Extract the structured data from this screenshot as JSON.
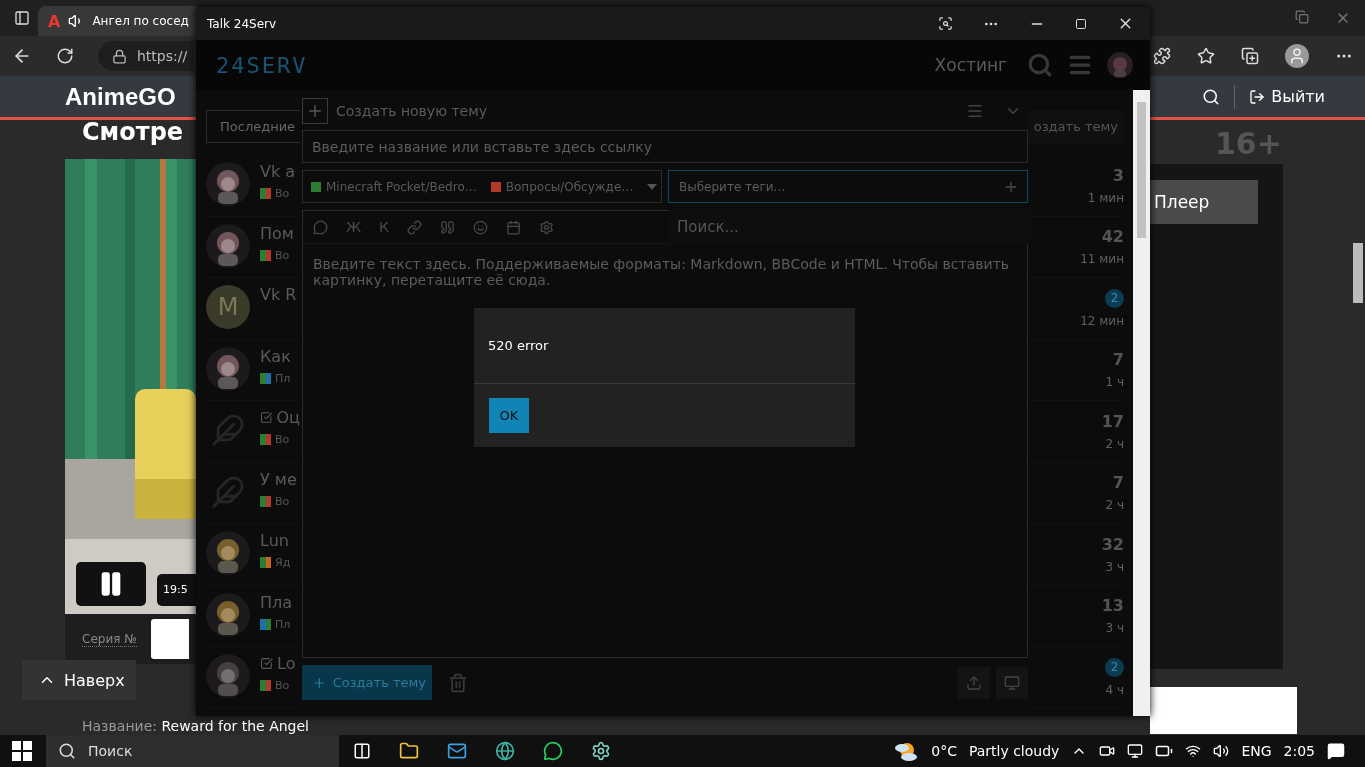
{
  "browser": {
    "tabs": [
      {
        "favicon": "A",
        "title": "Ангел по сосед",
        "selected": true
      }
    ],
    "address": "https://",
    "site": {
      "logo": "AnimeGO",
      "logout": "Выйти",
      "heading": "Смотре",
      "video_time": "19:5",
      "episode_label": "Серия №",
      "back_to_top": "Наверх",
      "title_label": "Название:",
      "title_value": "Reward for the Angel",
      "rating": "16+",
      "player_button": "Плеер"
    }
  },
  "app": {
    "title": "Talk 24Serv",
    "logo": "24SERV",
    "nav_link": "Хостинг",
    "filter": "Последние",
    "create_topic": "оздать тему",
    "topics": [
      {
        "title": "Vk a",
        "solved": false,
        "category": "Во",
        "tags": [
          {
            "color": "#2e7d32"
          },
          {
            "color": "#b23a2a"
          }
        ],
        "count": "3",
        "badge": false,
        "time": "1 мин"
      },
      {
        "title": "Пом",
        "solved": false,
        "category": "Во",
        "tags": [
          {
            "color": "#2e7d32"
          },
          {
            "color": "#b23a2a"
          }
        ],
        "count": "42",
        "badge": false,
        "time": "11 мин"
      },
      {
        "title": "Vk R",
        "solved": false,
        "avatar": {
          "kind": "letter",
          "letter": "M"
        },
        "count": "2",
        "badge": true,
        "time": "12 мин"
      },
      {
        "title": "Как",
        "solved": false,
        "category": "Пл",
        "tags": [
          {
            "color": "#2e7d32"
          },
          {
            "color": "#1f6fa8"
          }
        ],
        "count": "7",
        "badge": false,
        "time": "1 ч"
      },
      {
        "title": "Оц",
        "solved": true,
        "avatar": {
          "kind": "leaf"
        },
        "category": "Во",
        "tags": [
          {
            "color": "#2e7d32"
          },
          {
            "color": "#b23a2a"
          }
        ],
        "count": "17",
        "badge": false,
        "time": "2 ч"
      },
      {
        "title": "У ме",
        "solved": false,
        "avatar": {
          "kind": "leaf"
        },
        "category": "Во",
        "tags": [
          {
            "color": "#2e7d32"
          },
          {
            "color": "#b23a2a"
          }
        ],
        "count": "7",
        "badge": false,
        "time": "2 ч"
      },
      {
        "title": "Lun",
        "solved": false,
        "category": "Яд",
        "tags": [
          {
            "color": "#2e7d32"
          },
          {
            "color": "#c8641e"
          }
        ],
        "count": "32",
        "badge": false,
        "time": "3 ч"
      },
      {
        "title": "Пла",
        "solved": false,
        "category": "Пл",
        "tags": [
          {
            "color": "#1f6fa8"
          },
          {
            "color": "#2e7d32"
          }
        ],
        "count": "13",
        "badge": false,
        "time": "3 ч"
      },
      {
        "title": "Lo",
        "solved": true,
        "category": "Во",
        "tags": [
          {
            "color": "#2e7d32"
          },
          {
            "color": "#b23a2a"
          }
        ],
        "count": "2",
        "badge": true,
        "time": "4 ч"
      }
    ],
    "composer": {
      "header": "Создать новую тему",
      "title_placeholder": "Введите название или вставьте здесь ссылку",
      "categories": [
        {
          "label": "Minecraft Pocket/Bedro…",
          "color": "#2e7d32"
        },
        {
          "label": "Вопросы/Обсужде…",
          "color": "#b23a2a"
        }
      ],
      "tags_placeholder": "Выберите теги...",
      "tag_search_placeholder": "Поиск...",
      "bold_button": "Ж",
      "italic_button": "К",
      "body_placeholder": "Введите текст здесь. Поддерживаемые форматы: Markdown, BBCode и HTML. Чтобы вставить картинку, перетащите её сюда.",
      "submit": "Создать тему"
    },
    "modal": {
      "message": "520 error",
      "button": "OK"
    }
  },
  "taskbar": {
    "search": "Поиск",
    "temperature": "0°C",
    "weather": "Partly cloudy",
    "language": "ENG",
    "time": "2:05"
  }
}
